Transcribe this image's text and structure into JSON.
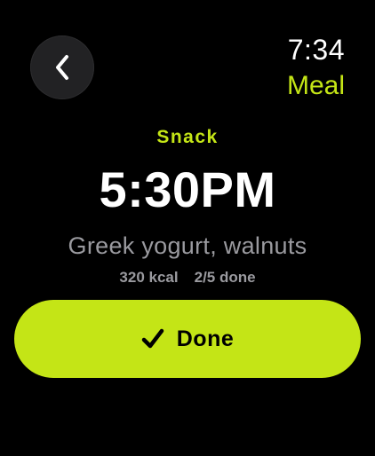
{
  "header": {
    "time": "7:34",
    "app_title": "Meal",
    "back_icon": "chevron-left-icon"
  },
  "meal": {
    "type": "Snack",
    "time": "5:30PM",
    "description": "Greek yogurt, walnuts",
    "calories": "320 kcal",
    "progress": "2/5 done"
  },
  "action": {
    "done_label": "Done",
    "done_icon": "checkmark-icon"
  },
  "colors": {
    "background": "#000000",
    "accent": "#c4e516",
    "secondary_text": "#9a9a9f",
    "back_button_bg": "#222224"
  }
}
